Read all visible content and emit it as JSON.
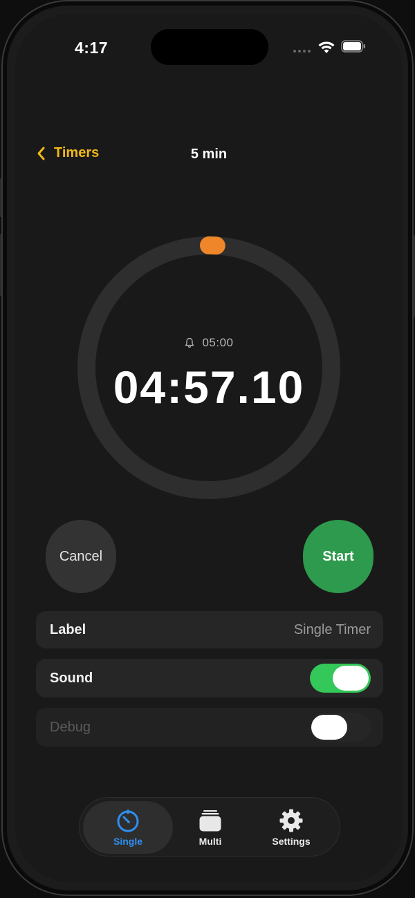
{
  "status_bar": {
    "time": "4:17"
  },
  "nav": {
    "back_label": "Timers",
    "title": "5 min"
  },
  "timer": {
    "alarm_label": "05:00",
    "remaining": "04:57.10",
    "progress_fraction": 0.0097,
    "colors": {
      "track": "#2e2e2e",
      "progress": "#f0862a"
    }
  },
  "buttons": {
    "cancel_label": "Cancel",
    "start_label": "Start",
    "start_color": "#2e9a4d"
  },
  "settings": {
    "label": {
      "title": "Label",
      "value": "Single Timer"
    },
    "sound": {
      "title": "Sound",
      "enabled": true
    },
    "debug": {
      "title": "Debug",
      "enabled": false
    }
  },
  "tabbar": {
    "tabs": [
      {
        "label": "Single",
        "icon": "timer-icon",
        "selected": true
      },
      {
        "label": "Multi",
        "icon": "stack-icon",
        "selected": false
      },
      {
        "label": "Settings",
        "icon": "gear-icon",
        "selected": false
      }
    ],
    "accent_color": "#2f8ff0"
  },
  "colors": {
    "accent": "#f2b91a",
    "toggle_on": "#34c759"
  }
}
